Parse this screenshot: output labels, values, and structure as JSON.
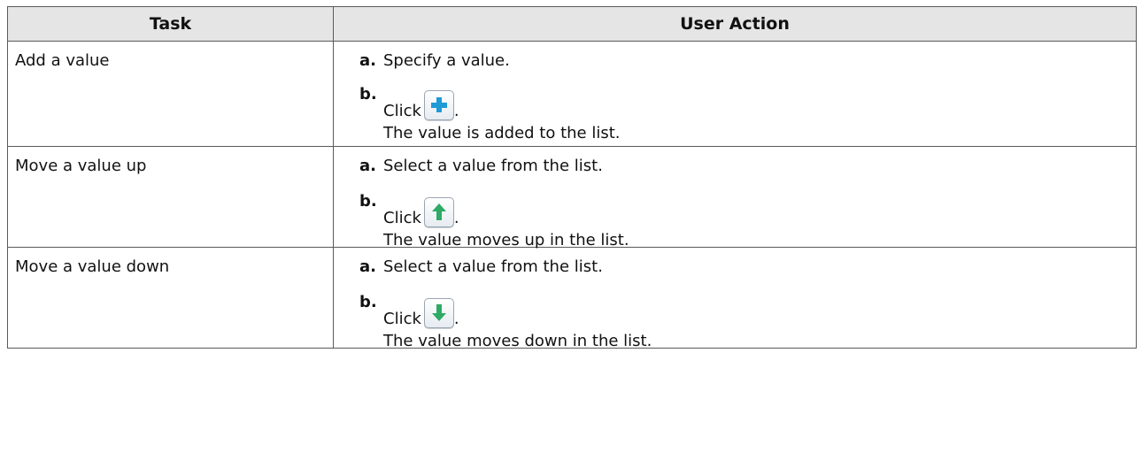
{
  "table": {
    "headers": {
      "task": "Task",
      "action": "User Action"
    },
    "rows": [
      {
        "task": "Add a value",
        "step_a_letter": "a.",
        "step_a_text": "Specify a value.",
        "step_b_letter": "b.",
        "click_label": "Click",
        "icon": "plus-icon",
        "period": ".",
        "result": "The value is added to the list."
      },
      {
        "task": "Move a value up",
        "step_a_letter": "a.",
        "step_a_text": "Select a value from the list.",
        "step_b_letter": "b.",
        "click_label": "Click",
        "icon": "arrow-up-icon",
        "period": ".",
        "result": "The value moves up in the list."
      },
      {
        "task": "Move a value down",
        "step_a_letter": "a.",
        "step_a_text": "Select a value from the list.",
        "step_b_letter": "b.",
        "click_label": "Click",
        "icon": "arrow-down-icon",
        "period": ".",
        "result": "The value moves down in the list."
      }
    ]
  },
  "colors": {
    "header_bg": "#e5e5e5",
    "border": "#5a5a5a",
    "plus_icon": "#1e9ad6",
    "arrow_icon": "#2eaa66"
  }
}
